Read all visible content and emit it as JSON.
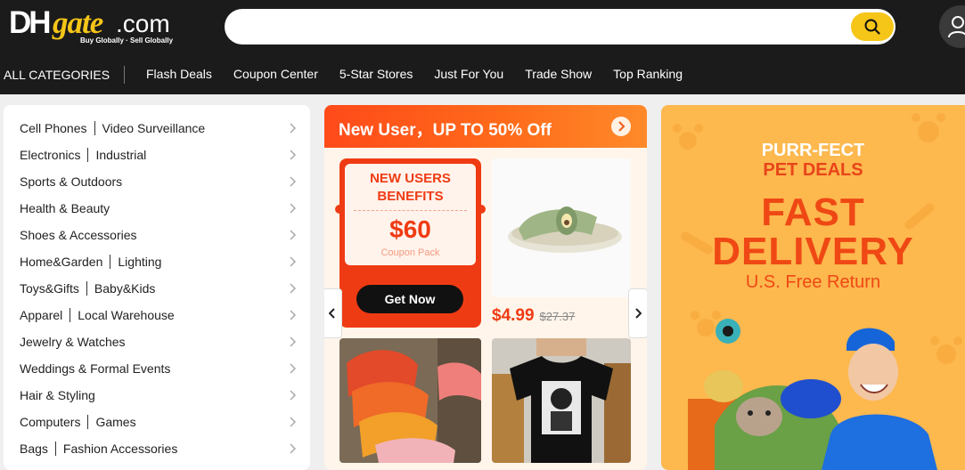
{
  "header": {
    "logo": {
      "dh": "DH",
      "gate": "gate",
      "com": ".com",
      "tagline": "Buy Globally · Sell Globally"
    },
    "search": {
      "value": "",
      "placeholder": ""
    },
    "nav": {
      "all_categories": "ALL CATEGORIES",
      "links": [
        "Flash Deals",
        "Coupon Center",
        "5-Star Stores",
        "Just For You",
        "Trade Show",
        "Top Ranking"
      ]
    }
  },
  "categories": [
    [
      "Cell Phones",
      "Video Surveillance"
    ],
    [
      "Electronics",
      "Industrial"
    ],
    [
      "Sports & Outdoors"
    ],
    [
      "Health & Beauty"
    ],
    [
      "Shoes & Accessories"
    ],
    [
      "Home&Garden",
      "Lighting"
    ],
    [
      "Toys&Gifts",
      "Baby&Kids"
    ],
    [
      "Apparel",
      "Local Warehouse"
    ],
    [
      "Jewelry & Watches"
    ],
    [
      "Weddings & Formal Events"
    ],
    [
      "Hair & Styling"
    ],
    [
      "Computers",
      "Games"
    ],
    [
      "Bags",
      "Fashion Accessories"
    ]
  ],
  "new_user": {
    "title": "New User，UP TO 50% Off",
    "coupon": {
      "line1": "NEW USERS",
      "line2": "BENEFITS",
      "amount": "$60",
      "pack": "Coupon Pack",
      "button": "Get Now"
    },
    "product": {
      "price": "$4.99",
      "old_price": "$27.37"
    }
  },
  "promo": {
    "line1": "PURR-FECT",
    "line2": "PET DEALS",
    "line3": "FAST",
    "line4": "DELIVERY",
    "line5": "U.S. Free Return"
  },
  "colors": {
    "accent": "#f5c518",
    "sale_red": "#ef3b13",
    "dark": "#1b1b1b",
    "promo_bg": "#fdb84e"
  }
}
